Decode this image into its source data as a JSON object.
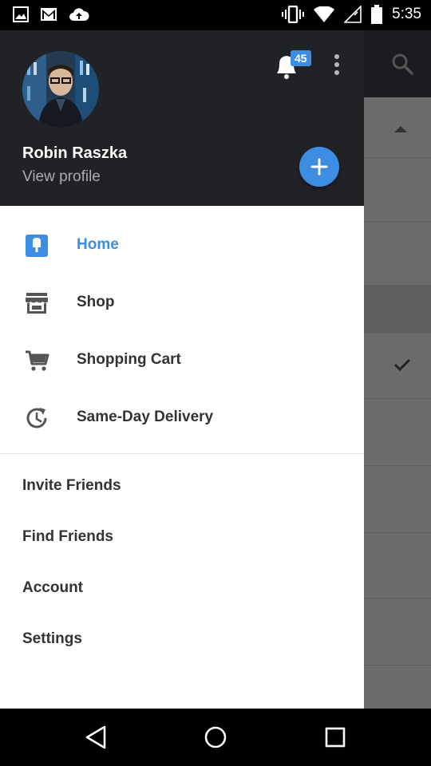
{
  "status_bar": {
    "time": "5:35",
    "left_icons": [
      "image-icon",
      "gmail-icon",
      "cloud-upload-icon"
    ],
    "right_icons": [
      "vibrate-icon",
      "wifi-icon",
      "signal-icon",
      "battery-icon"
    ]
  },
  "drawer": {
    "header": {
      "user_name": "Robin Raszka",
      "view_profile": "View profile",
      "notification_count": "45"
    },
    "nav_items": [
      {
        "label": "Home",
        "icon": "home-icon",
        "active": true
      },
      {
        "label": "Shop",
        "icon": "shop-icon",
        "active": false
      },
      {
        "label": "Shopping Cart",
        "icon": "cart-icon",
        "active": false
      },
      {
        "label": "Same-Day Delivery",
        "icon": "same-day-delivery-icon",
        "active": false
      }
    ],
    "secondary_items": [
      {
        "label": "Invite Friends"
      },
      {
        "label": "Find Friends"
      },
      {
        "label": "Account"
      },
      {
        "label": "Settings"
      }
    ]
  },
  "colors": {
    "accent": "#3d8de0",
    "header_bg": "#212226",
    "scrim": "#6b6b6b"
  },
  "system_nav": [
    "back-icon",
    "home-circle-icon",
    "recents-icon"
  ]
}
